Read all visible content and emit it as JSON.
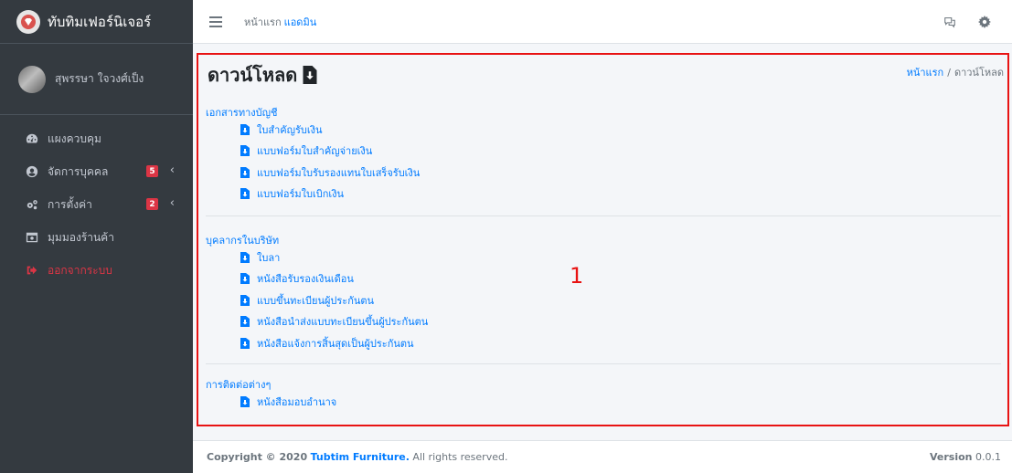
{
  "sidebar": {
    "brand": "ทับทิมเฟอร์นิเจอร์",
    "user_name": "สุพรรษา ใจวงศ์เป็ง",
    "items": [
      {
        "label": "แผงควบคุม",
        "icon": "dashboard-icon"
      },
      {
        "label": "จัดการบุคคล",
        "icon": "user-circle-icon",
        "badge": "5"
      },
      {
        "label": "การตั้งค่า",
        "icon": "gears-icon",
        "badge": "2"
      },
      {
        "label": "มุมมองร้านค้า",
        "icon": "store-window-icon"
      },
      {
        "label": "ออกจากระบบ",
        "icon": "sign-out-icon"
      }
    ]
  },
  "topbar": {
    "home": "หน้าแรก",
    "admin": "แอดมิน",
    "icons": [
      "comments-icon",
      "gear-icon"
    ]
  },
  "page": {
    "title": "ดาวน์โหลด",
    "breadcrumb": {
      "home": "หน้าแรก",
      "sep": "/",
      "current": "ดาวน์โหลด"
    },
    "marker": "1"
  },
  "sections": [
    {
      "title": "เอกสารทางบัญชี",
      "items": [
        "ใบสำคัญรับเงิน",
        "แบบฟอร์มใบสำคัญจ่ายเงิน",
        "แบบฟอร์มใบรับรองแทนใบเสร็จรับเงิน",
        "แบบฟอร์มใบเบิกเงิน"
      ]
    },
    {
      "title": "บุคลากรในบริษัท",
      "items": [
        "ใบลา",
        "หนังสือรับรองเงินเดือน",
        "แบบขึ้นทะเบียนผู้ประกันตน",
        "หนังสือนำส่งแบบทะเบียนขึ้นผู้ประกันตน",
        "หนังสือแจ้งการสิ้นสุดเป็นผู้ประกันตน"
      ]
    },
    {
      "title": "การติดต่อต่างๆ",
      "items": [
        "หนังสือมอบอำนาจ"
      ]
    }
  ],
  "footer": {
    "copyright": "Copyright © 2020",
    "company": "Tubtim Furniture.",
    "rights": "All rights reserved.",
    "version_label": "Version",
    "version": "0.0.1"
  },
  "colors": {
    "accent": "#007bff",
    "danger": "#dc3545",
    "sidebar": "#343a40",
    "highlight_box": "#e81313"
  }
}
